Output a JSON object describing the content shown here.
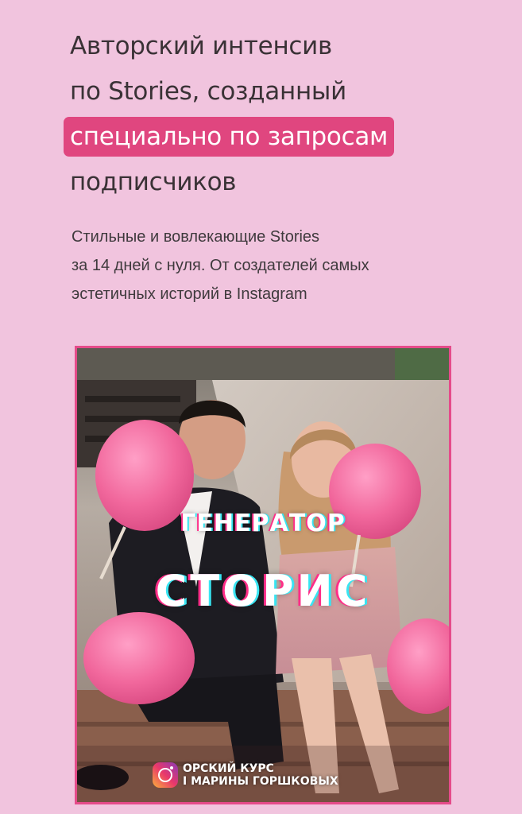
{
  "colors": {
    "background": "#f1c4de",
    "accent": "#e0467f",
    "cover_border": "#e54b8a",
    "text": "#3a3236"
  },
  "hero": {
    "title_line_1": "Авторский интенсив",
    "title_line_2": "по Stories, созданный",
    "title_highlight": "специально по запросам",
    "title_line_4": "подписчиков",
    "subtitle_line_1": "Стильные и вовлекающие Stories",
    "subtitle_line_2": "за 14 дней с нуля. От создателей самых",
    "subtitle_line_3": "эстетичных историй в Instagram"
  },
  "cover": {
    "kicker": "ГЕНЕРАТОР",
    "title": "СТОРИС",
    "brand_icon": "instagram-icon",
    "brand_line_1": "ОРСКИЙ КУРС",
    "brand_line_2": "І МАРИНЫ ГОРШКОВЫХ"
  }
}
